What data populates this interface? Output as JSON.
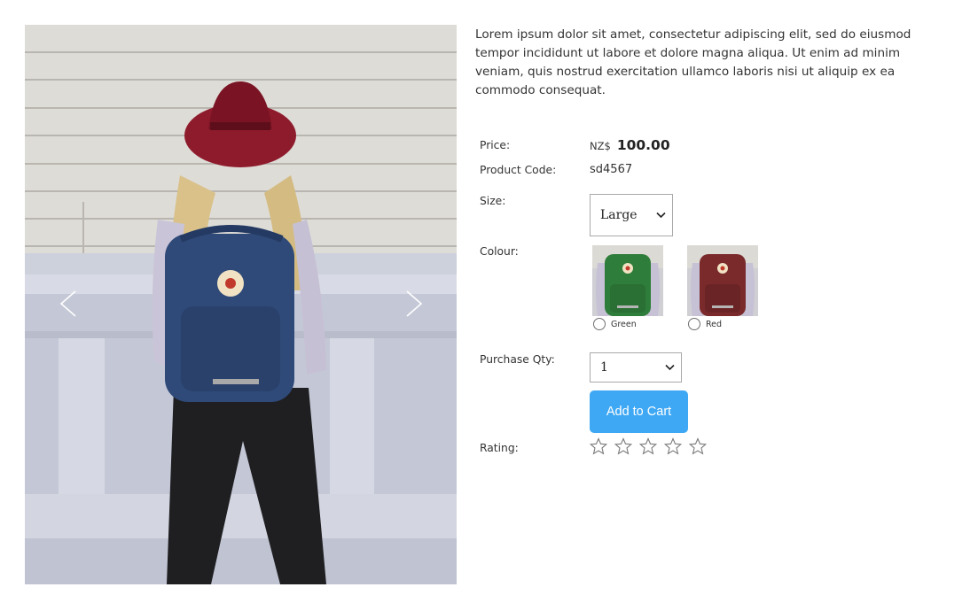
{
  "description": "Lorem ipsum dolor sit amet, consectetur adipiscing elit, sed do eiusmod tempor incididunt ut labore et dolore magna aliqua. Ut enim ad minim veniam, quis nostrud exercitation ullamco laboris nisi ut aliquip ex ea commodo consequat.",
  "price": {
    "label": "Price:",
    "currency": "NZ$",
    "amount": "100.00"
  },
  "product_code": {
    "label": "Product Code:",
    "value": "sd4567"
  },
  "size": {
    "label": "Size:",
    "selected": "Large"
  },
  "colour": {
    "label": "Colour:",
    "options": [
      {
        "name": "Green",
        "color": "#2f7d3a"
      },
      {
        "name": "Red",
        "color": "#7a2a2b"
      }
    ]
  },
  "quantity": {
    "label": "Purchase Qty:",
    "selected": "1"
  },
  "add_to_cart": {
    "label": "Add to Cart",
    "color": "#3ea8f4"
  },
  "rating": {
    "label": "Rating:",
    "value": 0,
    "max": 5
  },
  "gallery": {
    "prev_icon": "chevron-left-icon",
    "next_icon": "chevron-right-icon"
  }
}
